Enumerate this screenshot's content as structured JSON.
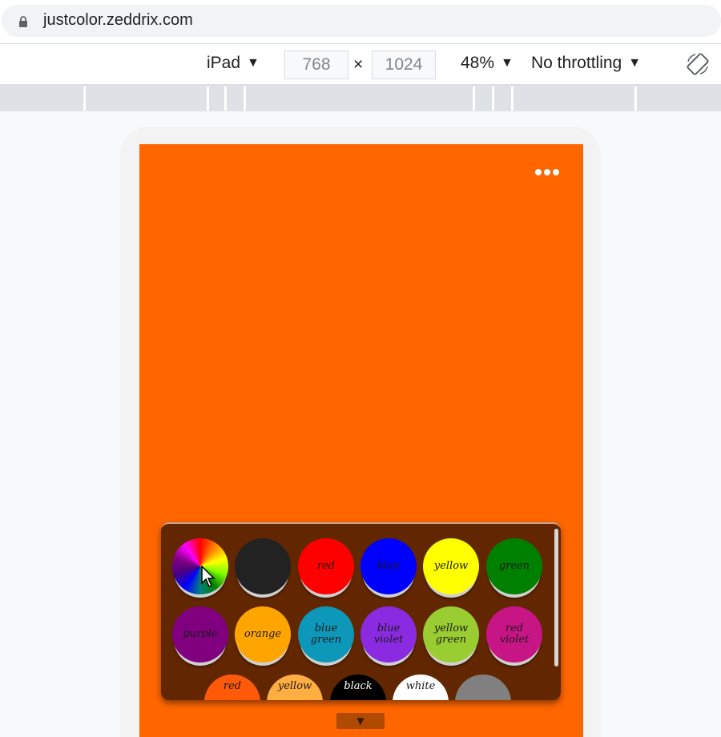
{
  "browser": {
    "url": "justcolor.zeddrix.com",
    "device": "iPad",
    "width": "768",
    "height": "1024",
    "zoom": "48%",
    "throttling": "No throttling",
    "times_sign": "×",
    "dropdown_arrow": "▼"
  },
  "app": {
    "background_color": "#ff6600",
    "menu_icon": "more-horizontal-icon",
    "toggle_label": "▼",
    "palette": {
      "row1": [
        {
          "label": "",
          "color": "wheel"
        },
        {
          "label": "",
          "color": "#222222"
        },
        {
          "label": "red",
          "color": "#ff0000"
        },
        {
          "label": "blue",
          "color": "#0000ff"
        },
        {
          "label": "yellow",
          "color": "#ffff00"
        },
        {
          "label": "green",
          "color": "#008000"
        }
      ],
      "row2": [
        {
          "label": "purple",
          "color": "#800080"
        },
        {
          "label": "orange",
          "color": "#ffa500"
        },
        {
          "label": "blue green",
          "color": "#0d98ba"
        },
        {
          "label": "blue violet",
          "color": "#8a2be2"
        },
        {
          "label": "yellow green",
          "color": "#9acd32"
        },
        {
          "label": "red violet",
          "color": "#c71585"
        }
      ],
      "row3": [
        {
          "label": "red",
          "color": "#ff5a0a"
        },
        {
          "label": "yellow",
          "color": "#ffae42"
        },
        {
          "label": "black",
          "color": "#000000"
        },
        {
          "label": "white",
          "color": "#ffffff"
        },
        {
          "label": "",
          "color": "#808080"
        }
      ]
    }
  }
}
